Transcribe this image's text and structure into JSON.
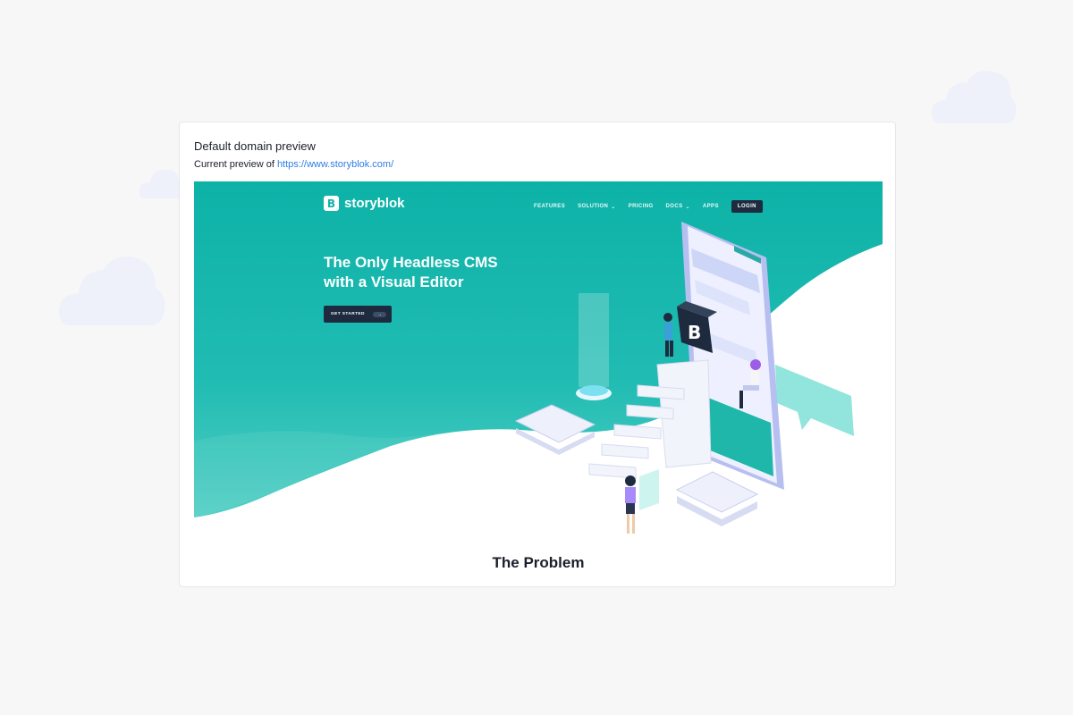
{
  "card": {
    "title": "Default domain preview",
    "subtitle_prefix": "Current preview of",
    "preview_url": "https://www.storyblok.com/"
  },
  "site": {
    "logo_mark": "B",
    "logo_text": "storyblok",
    "nav": [
      {
        "label": "FEATURES",
        "dropdown": false
      },
      {
        "label": "SOLUTION",
        "dropdown": true
      },
      {
        "label": "PRICING",
        "dropdown": false
      },
      {
        "label": "DOCS",
        "dropdown": true
      },
      {
        "label": "APPS",
        "dropdown": false
      }
    ],
    "login_label": "LOGIN",
    "headline_line1": "The Only Headless CMS",
    "headline_line2": "with a Visual Editor",
    "cta_label": "GET STARTED",
    "cta_arrow": "→",
    "next_section_title": "The Problem",
    "dropdown_glyph": "⌄"
  },
  "colors": {
    "page_bg": "#f7f7f8",
    "hero_teal": "#0fb3a8",
    "dark_navy": "#1e2b3f",
    "link_blue": "#2f7ee8",
    "cloud": "#eef0fa"
  }
}
